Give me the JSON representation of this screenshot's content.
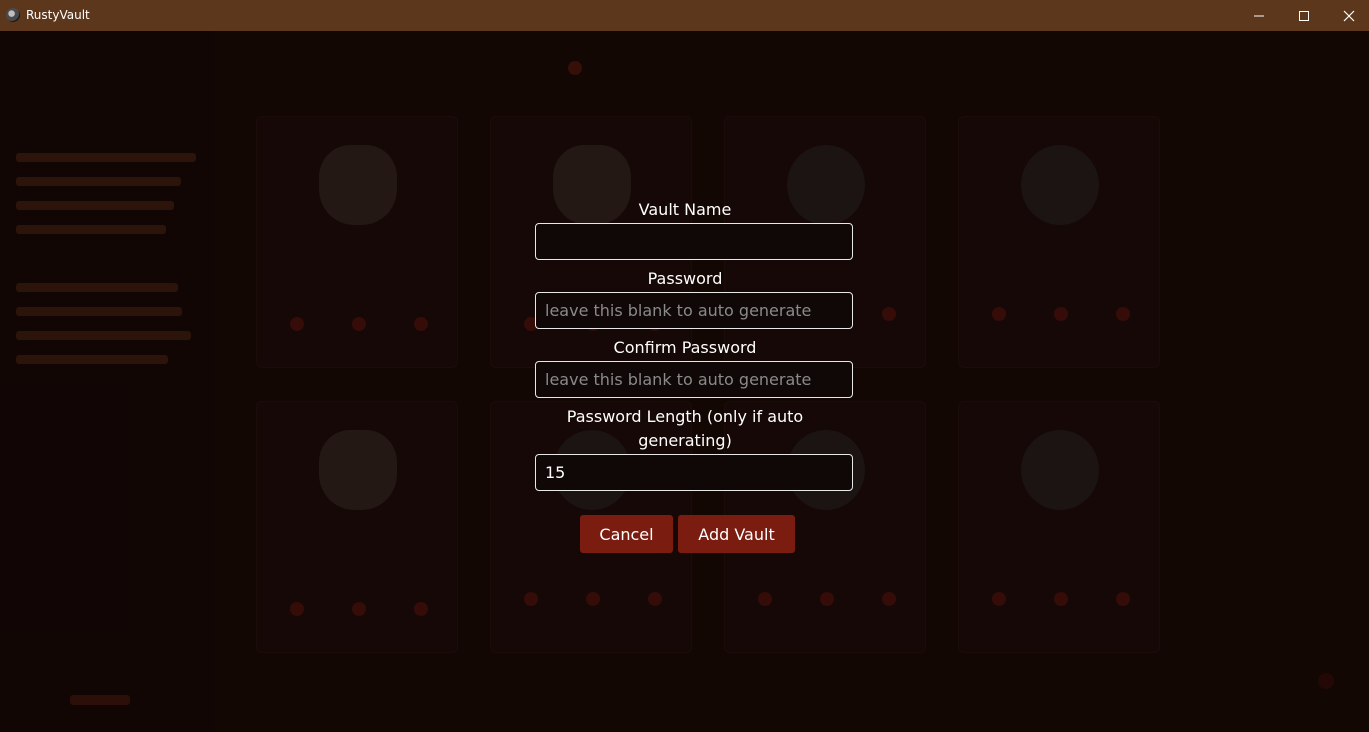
{
  "window": {
    "title": "RustyVault",
    "controls": [
      "minimize-icon",
      "maximize-icon",
      "close-icon"
    ]
  },
  "background": {
    "sidebar_title": "",
    "card_labels": [
      "",
      "",
      "",
      "",
      "",
      "",
      "",
      ""
    ]
  },
  "modal": {
    "vault_name_label": "Vault Name",
    "vault_name_value": "",
    "password_label": "Password",
    "password_placeholder": "leave this blank to auto generate",
    "confirm_password_label": "Confirm Password",
    "confirm_password_placeholder": "leave this blank to auto generate",
    "length_label": "Password Length (only if auto generating)",
    "length_value": "15",
    "cancel_label": "Cancel",
    "add_label": "Add Vault"
  },
  "colors": {
    "titlebar": "#5c371b",
    "button": "#7a1c10",
    "backdrop": "#120807"
  }
}
